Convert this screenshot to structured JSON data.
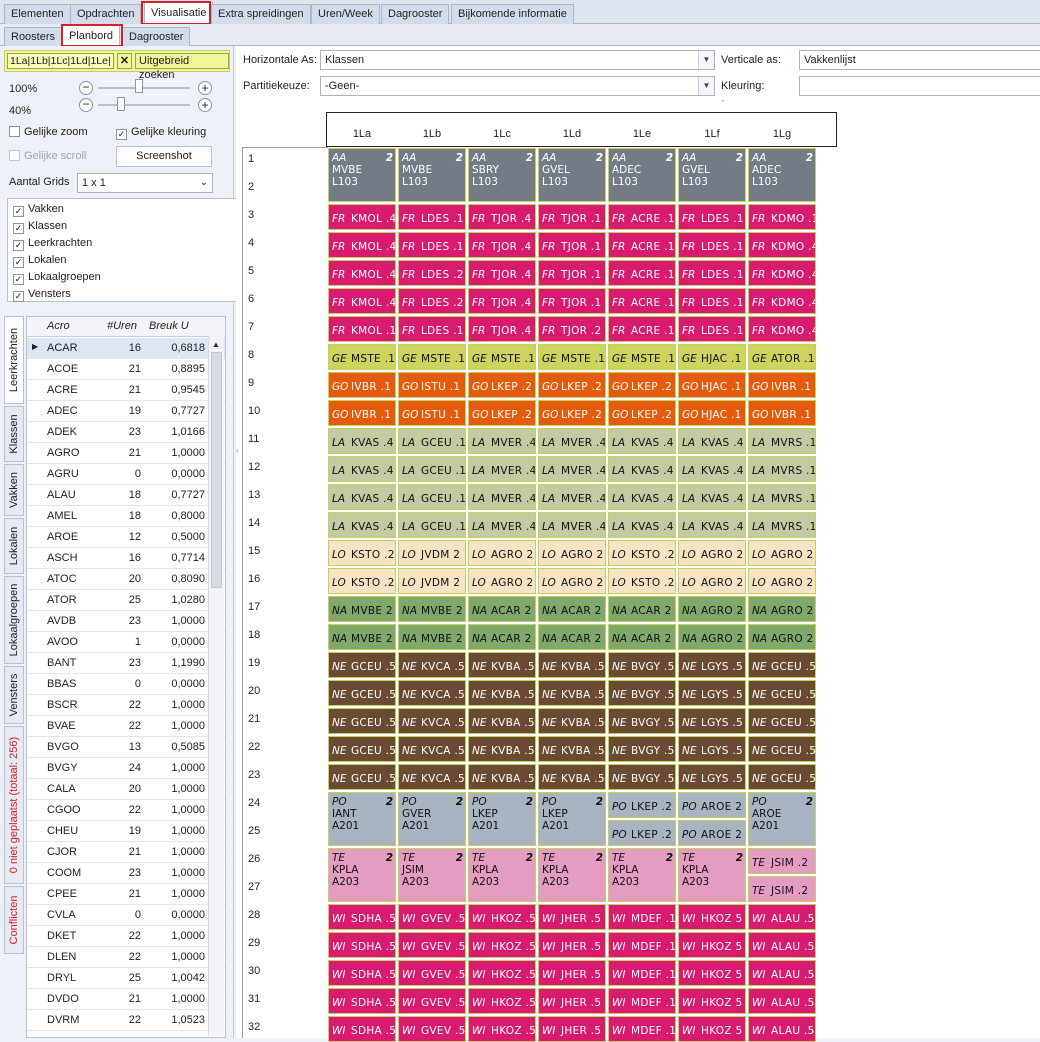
{
  "top_tabs": [
    "Elementen",
    "Opdrachten",
    "Visualisatie",
    "Extra spreidingen",
    "Uren/Week",
    "Dagrooster",
    "Bijkomende informatie"
  ],
  "sub_tabs": [
    "Roosters",
    "Planbord",
    "Dagrooster"
  ],
  "filter": {
    "classes": [
      "1La",
      "1Lb",
      "1Lc",
      "1Ld",
      "1Le"
    ],
    "clear": "✕",
    "search": "Uitgebreid zoeken"
  },
  "zoom": {
    "z1": "100%",
    "z2": "40%",
    "level1": 0.45,
    "level2": 0.25
  },
  "options": {
    "same_zoom": "Gelijke zoom",
    "same_color": "Gelijke kleuring",
    "same_scroll": "Gelijke scroll",
    "screenshot": "Screenshot",
    "grids_label": "Aantal Grids",
    "grids_value": "1 x 1"
  },
  "layers": [
    "Vakken",
    "Klassen",
    "Leerkrachten",
    "Lokalen",
    "Lokaalgroepen",
    "Vensters"
  ],
  "side_tabs": [
    "Leerkrachten",
    "Klassen",
    "Vakken",
    "Lokalen",
    "Lokaalgroepen",
    "Vensters",
    "0 niet geplaatst (totaal: 256)",
    "Conflicten"
  ],
  "table": {
    "headers": [
      "Acro",
      "#Uren",
      "Breuk U"
    ],
    "rows": [
      [
        "ACAR",
        "16",
        "0,6818"
      ],
      [
        "ACOE",
        "21",
        "0,8895"
      ],
      [
        "ACRE",
        "21",
        "0,9545"
      ],
      [
        "ADEC",
        "19",
        "0,7727"
      ],
      [
        "ADEK",
        "23",
        "1,0166"
      ],
      [
        "AGRO",
        "21",
        "1,0000"
      ],
      [
        "AGRU",
        "0",
        "0,0000"
      ],
      [
        "ALAU",
        "18",
        "0,7727"
      ],
      [
        "AMEL",
        "18",
        "0,8000"
      ],
      [
        "AROE",
        "12",
        "0,5000"
      ],
      [
        "ASCH",
        "16",
        "0,7714"
      ],
      [
        "ATOC",
        "20",
        "0,8090"
      ],
      [
        "ATOR",
        "25",
        "1,0280"
      ],
      [
        "AVDB",
        "23",
        "1,0000"
      ],
      [
        "AVOO",
        "1",
        "0,0000"
      ],
      [
        "BANT",
        "23",
        "1,1990"
      ],
      [
        "BBAS",
        "0",
        "0,0000"
      ],
      [
        "BSCR",
        "22",
        "1,0000"
      ],
      [
        "BVAE",
        "22",
        "1,0000"
      ],
      [
        "BVGO",
        "13",
        "0,5085"
      ],
      [
        "BVGY",
        "24",
        "1,0000"
      ],
      [
        "CALA",
        "20",
        "1,0000"
      ],
      [
        "CGOO",
        "22",
        "1,0000"
      ],
      [
        "CHEU",
        "19",
        "1,0000"
      ],
      [
        "CJOR",
        "21",
        "1,0000"
      ],
      [
        "COOM",
        "23",
        "1,0000"
      ],
      [
        "CPEE",
        "21",
        "1,0000"
      ],
      [
        "CVLA",
        "0",
        "0,0000"
      ],
      [
        "DKET",
        "22",
        "1,0000"
      ],
      [
        "DLEN",
        "22",
        "1,0000"
      ],
      [
        "DRYL",
        "25",
        "1,0042"
      ],
      [
        "DVDO",
        "21",
        "1,0000"
      ],
      [
        "DVRM",
        "22",
        "1,0523"
      ]
    ]
  },
  "axes": {
    "h_label": "Horizontale As:",
    "h_value": "Klassen",
    "v_label": "Verticale as:",
    "v_value": "Vakkenlijst",
    "p_label": "Partitiekeuze:",
    "p_value": "-Geen-",
    "k_label": "Kleuring:",
    "k_value": ""
  },
  "columns": [
    "1La",
    "1Lb",
    "1Lc",
    "1Ld",
    "1Le",
    "1Lf",
    "1Lg"
  ],
  "row_numbers": [
    "1",
    "2",
    "3",
    "4",
    "5",
    "6",
    "7",
    "8",
    "9",
    "10",
    "11",
    "12",
    "13",
    "14",
    "15",
    "16",
    "17",
    "18",
    "19",
    "20",
    "21",
    "22",
    "23",
    "24",
    "25",
    "26",
    "27",
    "28",
    "29",
    "30",
    "31",
    "32"
  ],
  "colors": {
    "AA": "#737b86",
    "FR": "#d81b6f",
    "GE": "#cdd35c",
    "GO": "#e55b0d",
    "LA": "#c3c9a1",
    "LO": "#f6e3c4",
    "NA": "#7fa86a",
    "NE": "#6b4a33",
    "PO": "#a9b4c3",
    "TE": "#e59cc3",
    "WI": "#d81b6f"
  },
  "blocks": [
    {
      "r": 1,
      "h": 2,
      "s": "AA",
      "cells": [
        [
          "MVBE",
          "L103",
          "2"
        ],
        [
          "MVBE",
          "L103",
          "2"
        ],
        [
          "SBRY",
          "L103",
          "2"
        ],
        [
          "GVEL",
          "L103",
          "2"
        ],
        [
          "ADEC",
          "L103",
          "2"
        ],
        [
          "GVEL",
          "L103",
          "2"
        ],
        [
          "ADEC",
          "L103",
          "2"
        ]
      ]
    },
    {
      "r": 3,
      "h": 1,
      "s": "FR",
      "cells": [
        "KMOL .4",
        "LDES .1",
        "TJOR .4",
        "TJOR .1",
        "ACRE .1",
        "LDES .1",
        "KDMO .1"
      ]
    },
    {
      "r": 4,
      "h": 1,
      "s": "FR",
      "cells": [
        "KMOL .4",
        "LDES .1",
        "TJOR .4",
        "TJOR .1",
        "ACRE .1",
        "LDES .1",
        "KDMO .4"
      ]
    },
    {
      "r": 5,
      "h": 1,
      "s": "FR",
      "cells": [
        "KMOL .4",
        "LDES .2",
        "TJOR .4",
        "TJOR .1",
        "ACRE .1",
        "LDES .1",
        "KDMO .4"
      ]
    },
    {
      "r": 6,
      "h": 1,
      "s": "FR",
      "cells": [
        "KMOL .4",
        "LDES .2",
        "TJOR .4",
        "TJOR .1",
        "ACRE .1",
        "LDES .1",
        "KDMO .4"
      ]
    },
    {
      "r": 7,
      "h": 1,
      "s": "FR",
      "cells": [
        "KMOL .1",
        "LDES .1",
        "TJOR .4",
        "TJOR .2",
        "ACRE .1",
        "LDES .1",
        "KDMO .4"
      ]
    },
    {
      "r": 8,
      "h": 1,
      "s": "GE",
      "cells": [
        "MSTE .1",
        "MSTE .1",
        "MSTE .1",
        "MSTE .1",
        "MSTE .1",
        "HJAC .1",
        "ATOR .1"
      ]
    },
    {
      "r": 9,
      "h": 1,
      "s": "GO",
      "cells": [
        "IVBR .1",
        "ISTU .1",
        "LKEP .2",
        "LKEP .2",
        "LKEP .2",
        "HJAC .1",
        "IVBR .1"
      ]
    },
    {
      "r": 10,
      "h": 1,
      "s": "GO",
      "cells": [
        "IVBR .1",
        "ISTU .1",
        "LKEP .2",
        "LKEP .2",
        "LKEP .2",
        "HJAC .1",
        "IVBR .1"
      ]
    },
    {
      "r": 11,
      "h": 1,
      "s": "LA",
      "cells": [
        "KVAS .4",
        "GCEU .1",
        "MVER .4",
        "MVER .4",
        "KVAS .4",
        "KVAS .4",
        "MVRS .1"
      ]
    },
    {
      "r": 12,
      "h": 1,
      "s": "LA",
      "cells": [
        "KVAS .4",
        "GCEU .1",
        "MVER .4",
        "MVER .4",
        "KVAS .4",
        "KVAS .4",
        "MVRS .1"
      ]
    },
    {
      "r": 13,
      "h": 1,
      "s": "LA",
      "cells": [
        "KVAS .4",
        "GCEU .1",
        "MVER .4",
        "MVER .4",
        "KVAS .4",
        "KVAS .4",
        "MVRS .1"
      ]
    },
    {
      "r": 14,
      "h": 1,
      "s": "LA",
      "cells": [
        "KVAS .4",
        "GCEU .1",
        "MVER .4",
        "MVER .4",
        "KVAS .4",
        "KVAS .4",
        "MVRS .1"
      ]
    },
    {
      "r": 15,
      "h": 1,
      "s": "LO",
      "cells": [
        "KSTO .2",
        "JVDM 2",
        "AGRO 2",
        "AGRO 2",
        "KSTO .2",
        "AGRO 2",
        "AGRO 2"
      ]
    },
    {
      "r": 16,
      "h": 1,
      "s": "LO",
      "cells": [
        "KSTO .2",
        "JVDM 2",
        "AGRO 2",
        "AGRO 2",
        "KSTO .2",
        "AGRO 2",
        "AGRO 2"
      ]
    },
    {
      "r": 17,
      "h": 1,
      "s": "NA",
      "cells": [
        "MVBE 2",
        "MVBE 2",
        "ACAR 2",
        "ACAR 2",
        "ACAR 2",
        "AGRO 2",
        "AGRO 2"
      ]
    },
    {
      "r": 18,
      "h": 1,
      "s": "NA",
      "cells": [
        "MVBE 2",
        "MVBE 2",
        "ACAR 2",
        "ACAR 2",
        "ACAR 2",
        "AGRO 2",
        "AGRO 2"
      ]
    },
    {
      "r": 19,
      "h": 1,
      "s": "NE",
      "cells": [
        "GCEU .5",
        "KVCA .5",
        "KVBA .5",
        "KVBA .5",
        "BVGY .5",
        "LGYS .5",
        "GCEU .5"
      ]
    },
    {
      "r": 20,
      "h": 1,
      "s": "NE",
      "cells": [
        "GCEU .5",
        "KVCA .5",
        "KVBA .5",
        "KVBA .5",
        "BVGY .5",
        "LGYS .5",
        "GCEU .5"
      ]
    },
    {
      "r": 21,
      "h": 1,
      "s": "NE",
      "cells": [
        "GCEU .5",
        "KVCA .5",
        "KVBA .5",
        "KVBA .5",
        "BVGY .5",
        "LGYS .5",
        "GCEU .5"
      ]
    },
    {
      "r": 22,
      "h": 1,
      "s": "NE",
      "cells": [
        "GCEU .5",
        "KVCA .5",
        "KVBA .5",
        "KVBA .5",
        "BVGY .5",
        "LGYS .5",
        "GCEU .5"
      ]
    },
    {
      "r": 23,
      "h": 1,
      "s": "NE",
      "cells": [
        "GCEU .5",
        "KVCA .5",
        "KVBA .5",
        "KVBA .5",
        "BVGY .5",
        "LGYS .5",
        "GCEU .5"
      ]
    },
    {
      "r": 24,
      "h": 2,
      "s": "PO",
      "cells": [
        [
          "IANT",
          "A201",
          "2"
        ],
        [
          "GVER",
          "A201",
          "2"
        ],
        [
          "LKEP",
          "A201",
          "2"
        ],
        [
          "LKEP",
          "A201",
          "2"
        ],
        "LKEP .2|LKEP .2",
        "AROE 2|AROE 2",
        [
          "AROE",
          "A201",
          "2"
        ]
      ]
    },
    {
      "r": 26,
      "h": 2,
      "s": "TE",
      "cells": [
        [
          "KPLA",
          "A203",
          "2"
        ],
        [
          "JSIM",
          "A203",
          "2"
        ],
        [
          "KPLA",
          "A203",
          "2"
        ],
        [
          "KPLA",
          "A203",
          "2"
        ],
        [
          "KPLA",
          "A203",
          "2"
        ],
        [
          "KPLA",
          "A203",
          "2"
        ],
        "JSIM .2|JSIM .2"
      ]
    },
    {
      "r": 28,
      "h": 1,
      "s": "WI",
      "cells": [
        "SDHA .5",
        "GVEV .5",
        "HKOZ .5",
        "JHER .5",
        "MDEF .1",
        "HKOZ 5",
        "ALAU .5"
      ]
    },
    {
      "r": 29,
      "h": 1,
      "s": "WI",
      "cells": [
        "SDHA .5",
        "GVEV .5",
        "HKOZ .5",
        "JHER .5",
        "MDEF .1",
        "HKOZ 5",
        "ALAU .5"
      ]
    },
    {
      "r": 30,
      "h": 1,
      "s": "WI",
      "cells": [
        "SDHA .5",
        "GVEV .5",
        "HKOZ .5",
        "JHER .5",
        "MDEF .1",
        "HKOZ 5",
        "ALAU .5"
      ]
    },
    {
      "r": 31,
      "h": 1,
      "s": "WI",
      "cells": [
        "SDHA .5",
        "GVEV .5",
        "HKOZ .5",
        "JHER .5",
        "MDEF .1",
        "HKOZ 5",
        "ALAU .5"
      ]
    },
    {
      "r": 32,
      "h": 1,
      "s": "WI",
      "cells": [
        "SDHA .5",
        "GVEV .5",
        "HKOZ .5",
        "JHER .5",
        "MDEF .1",
        "HKOZ 5",
        "ALAU .5"
      ]
    }
  ]
}
